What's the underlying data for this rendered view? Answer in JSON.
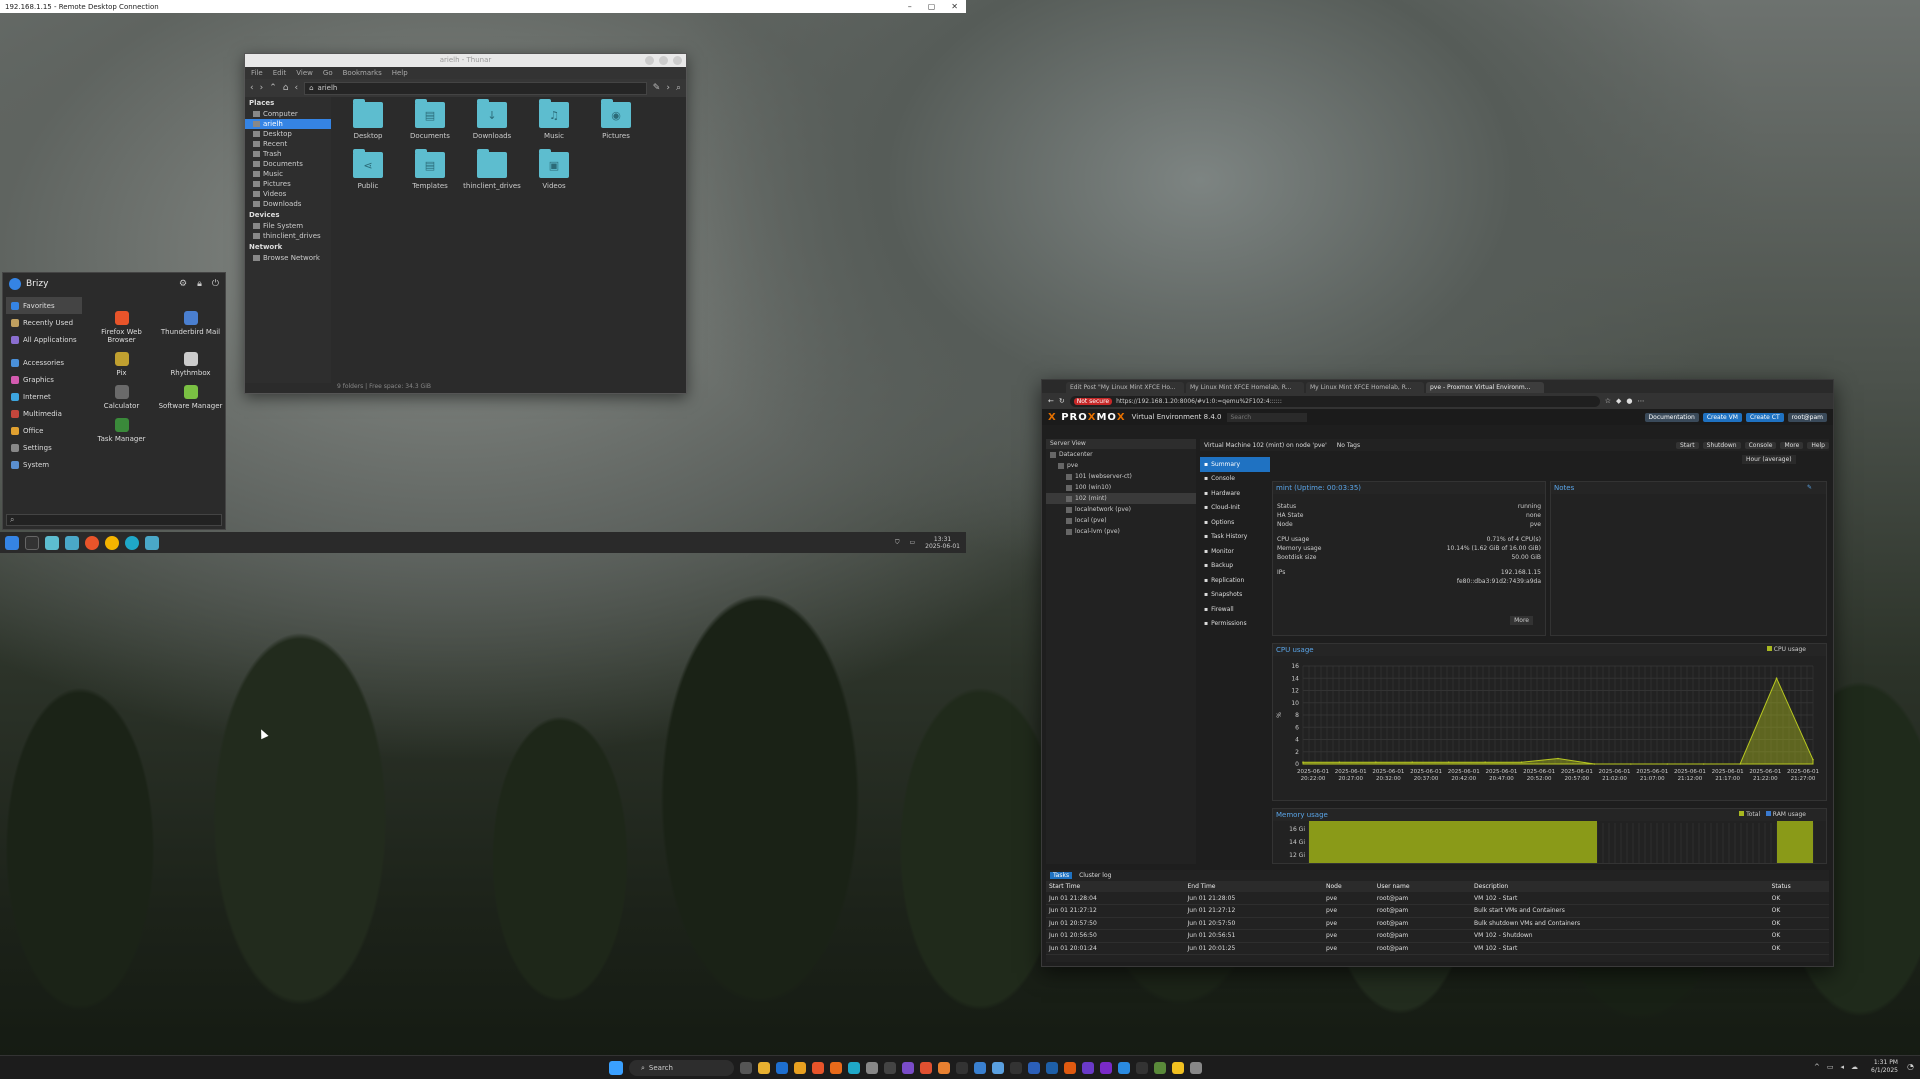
{
  "rdp": {
    "title": "192.168.1.15 - Remote Desktop Connection",
    "controls": [
      "–",
      "▢",
      "✕"
    ]
  },
  "thunar": {
    "title": "arielh - Thunar",
    "menu": [
      "File",
      "Edit",
      "View",
      "Go",
      "Bookmarks",
      "Help"
    ],
    "path": "arielh",
    "places_header": "Places",
    "places": [
      "Computer",
      "arielh",
      "Desktop",
      "Recent",
      "Trash",
      "Documents",
      "Music",
      "Pictures",
      "Videos",
      "Downloads"
    ],
    "devices_header": "Devices",
    "devices": [
      "File System",
      "thinclient_drives"
    ],
    "network_header": "Network",
    "network": [
      "Browse Network"
    ],
    "files": [
      {
        "name": "Desktop",
        "glyph": ""
      },
      {
        "name": "Documents",
        "glyph": "▤"
      },
      {
        "name": "Downloads",
        "glyph": "↓"
      },
      {
        "name": "Music",
        "glyph": "♫"
      },
      {
        "name": "Pictures",
        "glyph": "◉"
      },
      {
        "name": "Public",
        "glyph": "⋖"
      },
      {
        "name": "Templates",
        "glyph": "▤"
      },
      {
        "name": "thinclient_drives",
        "glyph": ""
      },
      {
        "name": "Videos",
        "glyph": "▣"
      }
    ],
    "status": "9 folders | Free space: 34.3 GiB"
  },
  "whisker": {
    "user": "Brizy",
    "categories": [
      {
        "label": "Favorites",
        "color": "#3584e4"
      },
      {
        "label": "Recently Used",
        "color": "#c0a060"
      },
      {
        "label": "All Applications",
        "color": "#8a6ed0"
      },
      {
        "label": "Accessories",
        "color": "#4a90d9"
      },
      {
        "label": "Graphics",
        "color": "#d45bb0"
      },
      {
        "label": "Internet",
        "color": "#3da6e0"
      },
      {
        "label": "Multimedia",
        "color": "#c4463c"
      },
      {
        "label": "Office",
        "color": "#e0a030"
      },
      {
        "label": "Settings",
        "color": "#888888"
      },
      {
        "label": "System",
        "color": "#5a8fd0"
      }
    ],
    "apps": [
      {
        "label": "Firefox Web Browser",
        "color": "#e8542a"
      },
      {
        "label": "Thunderbird Mail",
        "color": "#4a7fd0"
      },
      {
        "label": "Pix",
        "color": "#c0a030"
      },
      {
        "label": "Rhythmbox",
        "color": "#cccccc"
      },
      {
        "label": "Calculator",
        "color": "#6a6a6a"
      },
      {
        "label": "Software Manager",
        "color": "#7ac043"
      },
      {
        "label": "Task Manager",
        "color": "#3a8a3a"
      }
    ],
    "search_placeholder": ""
  },
  "xfce_panel": {
    "time": "13:31",
    "date": "2025-06-01"
  },
  "browser": {
    "tabs": [
      "Edit Post \"My Linux Mint XFCE Ho...",
      "My Linux Mint XFCE Homelab, R...",
      "My Linux Mint XFCE Homelab, R...",
      "pve - Proxmox Virtual Environm..."
    ],
    "not_secure": "Not secure",
    "url": "https://192.168.1.20:8006/#v1:0:=qemu%2F102:4::::::",
    "product": "Virtual Environment 8.4.0",
    "search_placeholder": "Search",
    "header_buttons": [
      "Documentation",
      "Create VM",
      "Create CT",
      "root@pam"
    ],
    "server_view": "Server View",
    "tree": [
      "Datacenter",
      "pve",
      "101 (webserver-ct)",
      "100 (win10)",
      "102 (mint)",
      "localnetwork (pve)",
      "local (pve)",
      "local-lvm (pve)"
    ],
    "vm_title": "Virtual Machine 102 (mint) on node 'pve'",
    "no_tags": "No Tags",
    "vm_actions": [
      "Start",
      "Shutdown",
      "Console",
      "More",
      "Help"
    ],
    "timeframe": "Hour (average)",
    "nav": [
      "Summary",
      "Console",
      "Hardware",
      "Cloud-Init",
      "Options",
      "Task History",
      "Monitor",
      "Backup",
      "Replication",
      "Snapshots",
      "Firewall",
      "Permissions"
    ],
    "status_title": "mint (Uptime: 00:03:35)",
    "status": [
      {
        "k": "Status",
        "v": "running"
      },
      {
        "k": "HA State",
        "v": "none"
      },
      {
        "k": "Node",
        "v": "pve"
      },
      {
        "k": "CPU usage",
        "v": "0.71% of 4 CPU(s)"
      },
      {
        "k": "Memory usage",
        "v": "10.14% (1.62 GiB of 16.00 GiB)"
      },
      {
        "k": "Bootdisk size",
        "v": "50.00 GiB"
      },
      {
        "k": "IPs",
        "v": "192.168.1.15"
      },
      {
        "k": "",
        "v": "fe80::dba3:91d2:7439:a9da"
      }
    ],
    "more_label": "More",
    "notes_title": "Notes",
    "cpu_title": "CPU usage",
    "cpu_legend": "CPU usage",
    "mem_title": "Memory usage",
    "mem_legend": [
      "Total",
      "RAM usage"
    ],
    "tasks_tabs": [
      "Tasks",
      "Cluster log"
    ],
    "task_headers": [
      "Start Time",
      "End Time",
      "Node",
      "User name",
      "Description",
      "Status"
    ],
    "task_rows": [
      [
        "Jun 01 21:28:04",
        "Jun 01 21:28:05",
        "pve",
        "root@pam",
        "VM 102 - Start",
        "OK"
      ],
      [
        "Jun 01 21:27:12",
        "Jun 01 21:27:12",
        "pve",
        "root@pam",
        "Bulk start VMs and Containers",
        "OK"
      ],
      [
        "Jun 01 20:57:50",
        "Jun 01 20:57:50",
        "pve",
        "root@pam",
        "Bulk shutdown VMs and Containers",
        "OK"
      ],
      [
        "Jun 01 20:56:50",
        "Jun 01 20:56:51",
        "pve",
        "root@pam",
        "VM 102 - Shutdown",
        "OK"
      ],
      [
        "Jun 01 20:01:24",
        "Jun 01 20:01:25",
        "pve",
        "root@pam",
        "VM 102 - Start",
        "OK"
      ]
    ]
  },
  "chart_data": [
    {
      "type": "area",
      "title": "CPU usage",
      "ylabel": "%",
      "ylim": [
        0,
        16
      ],
      "yticks": [
        0,
        2,
        4,
        6,
        8,
        10,
        12,
        14,
        16
      ],
      "x": [
        "2025-06-01 20:22:00",
        "2025-06-01 20:27:00",
        "2025-06-01 20:32:00",
        "2025-06-01 20:37:00",
        "2025-06-01 20:42:00",
        "2025-06-01 20:47:00",
        "2025-06-01 20:52:00",
        "2025-06-01 20:57:00",
        "2025-06-01 21:02:00",
        "2025-06-01 21:07:00",
        "2025-06-01 21:12:00",
        "2025-06-01 21:17:00",
        "2025-06-01 21:22:00",
        "2025-06-01 21:27:00"
      ],
      "series": [
        {
          "name": "CPU usage",
          "values": [
            0.3,
            0.3,
            0.3,
            0.3,
            0.3,
            0.3,
            0.3,
            0.9,
            0,
            0,
            0,
            0,
            0,
            14,
            0.7
          ]
        }
      ]
    },
    {
      "type": "area",
      "title": "Memory usage",
      "ylim": [
        0,
        16
      ],
      "yticks": [
        "12 Gi",
        "14 Gi",
        "16 Gi"
      ],
      "series": [
        {
          "name": "RAM usage",
          "values": [
            15,
            15,
            15,
            15,
            15,
            15,
            15,
            15,
            0,
            0,
            0,
            0,
            0,
            15
          ]
        }
      ]
    }
  ],
  "taskbar": {
    "search": "Search",
    "time": "1:31 PM",
    "date": "6/1/2025"
  }
}
